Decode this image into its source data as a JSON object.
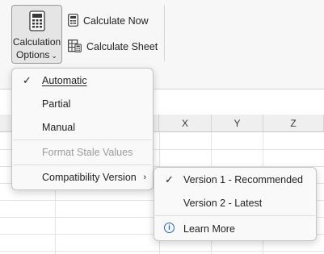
{
  "ribbon": {
    "calc_options": {
      "line1": "Calculation",
      "line2": "Options"
    },
    "calculate_now": "Calculate Now",
    "calculate_sheet": "Calculate Sheet"
  },
  "sheet": {
    "columns": [
      "X",
      "Y",
      "Z"
    ]
  },
  "menu": {
    "items": [
      {
        "label": "Automatic",
        "checked": true
      },
      {
        "label": "Partial"
      },
      {
        "label": "Manual"
      },
      {
        "label": "Format Stale Values",
        "disabled": true
      },
      {
        "label": "Compatibility Version",
        "submenu": true
      }
    ]
  },
  "submenu": {
    "items": [
      {
        "label": "Version 1 - Recommended",
        "checked": true
      },
      {
        "label": "Version 2 - Latest"
      },
      {
        "label": "Learn More"
      }
    ]
  },
  "colors": {
    "accent": "#1a66c4",
    "disabled": "#9b9b9b"
  }
}
